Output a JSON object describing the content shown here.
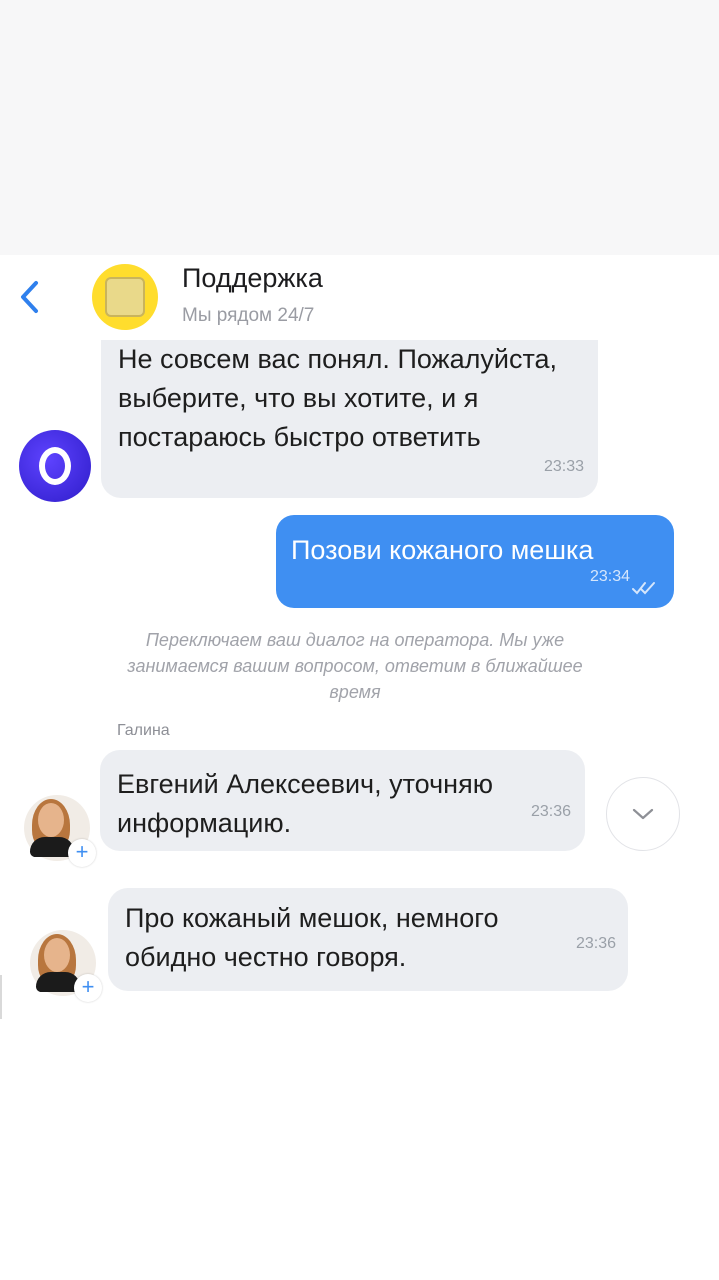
{
  "header": {
    "title": "Поддержка",
    "subtitle": "Мы рядом 24/7",
    "back_icon": "chevron-left-icon",
    "avatar": "bank-logo"
  },
  "messages": [
    {
      "type": "incoming",
      "sender": "bot",
      "text": "Не совсем вас понял. Пожалуйста, выберите, что вы хотите, и я постараюсь быстро ответить",
      "time": "23:33"
    },
    {
      "type": "outgoing",
      "text": "Позови кожаного мешка",
      "time": "23:34",
      "status": "read"
    },
    {
      "type": "system",
      "text": "Переключаем ваш диалог на оператора. Мы уже занимаемся вашим вопросом, ответим в ближайшее время"
    },
    {
      "type": "incoming",
      "sender": "Галина",
      "text": "Евгений Алексеевич, уточняю информацию.",
      "time": "23:36"
    },
    {
      "type": "incoming",
      "sender": "Галина",
      "text": "Про кожаный мешок, немного обидно честно говоря.",
      "time": "23:36"
    }
  ],
  "operator_name": "Галина",
  "colors": {
    "outgoing_bubble": "#3f8ff2",
    "incoming_bubble": "#eceef2",
    "brand_yellow": "#ffdd2d",
    "bot_avatar": "#4a33ee"
  }
}
